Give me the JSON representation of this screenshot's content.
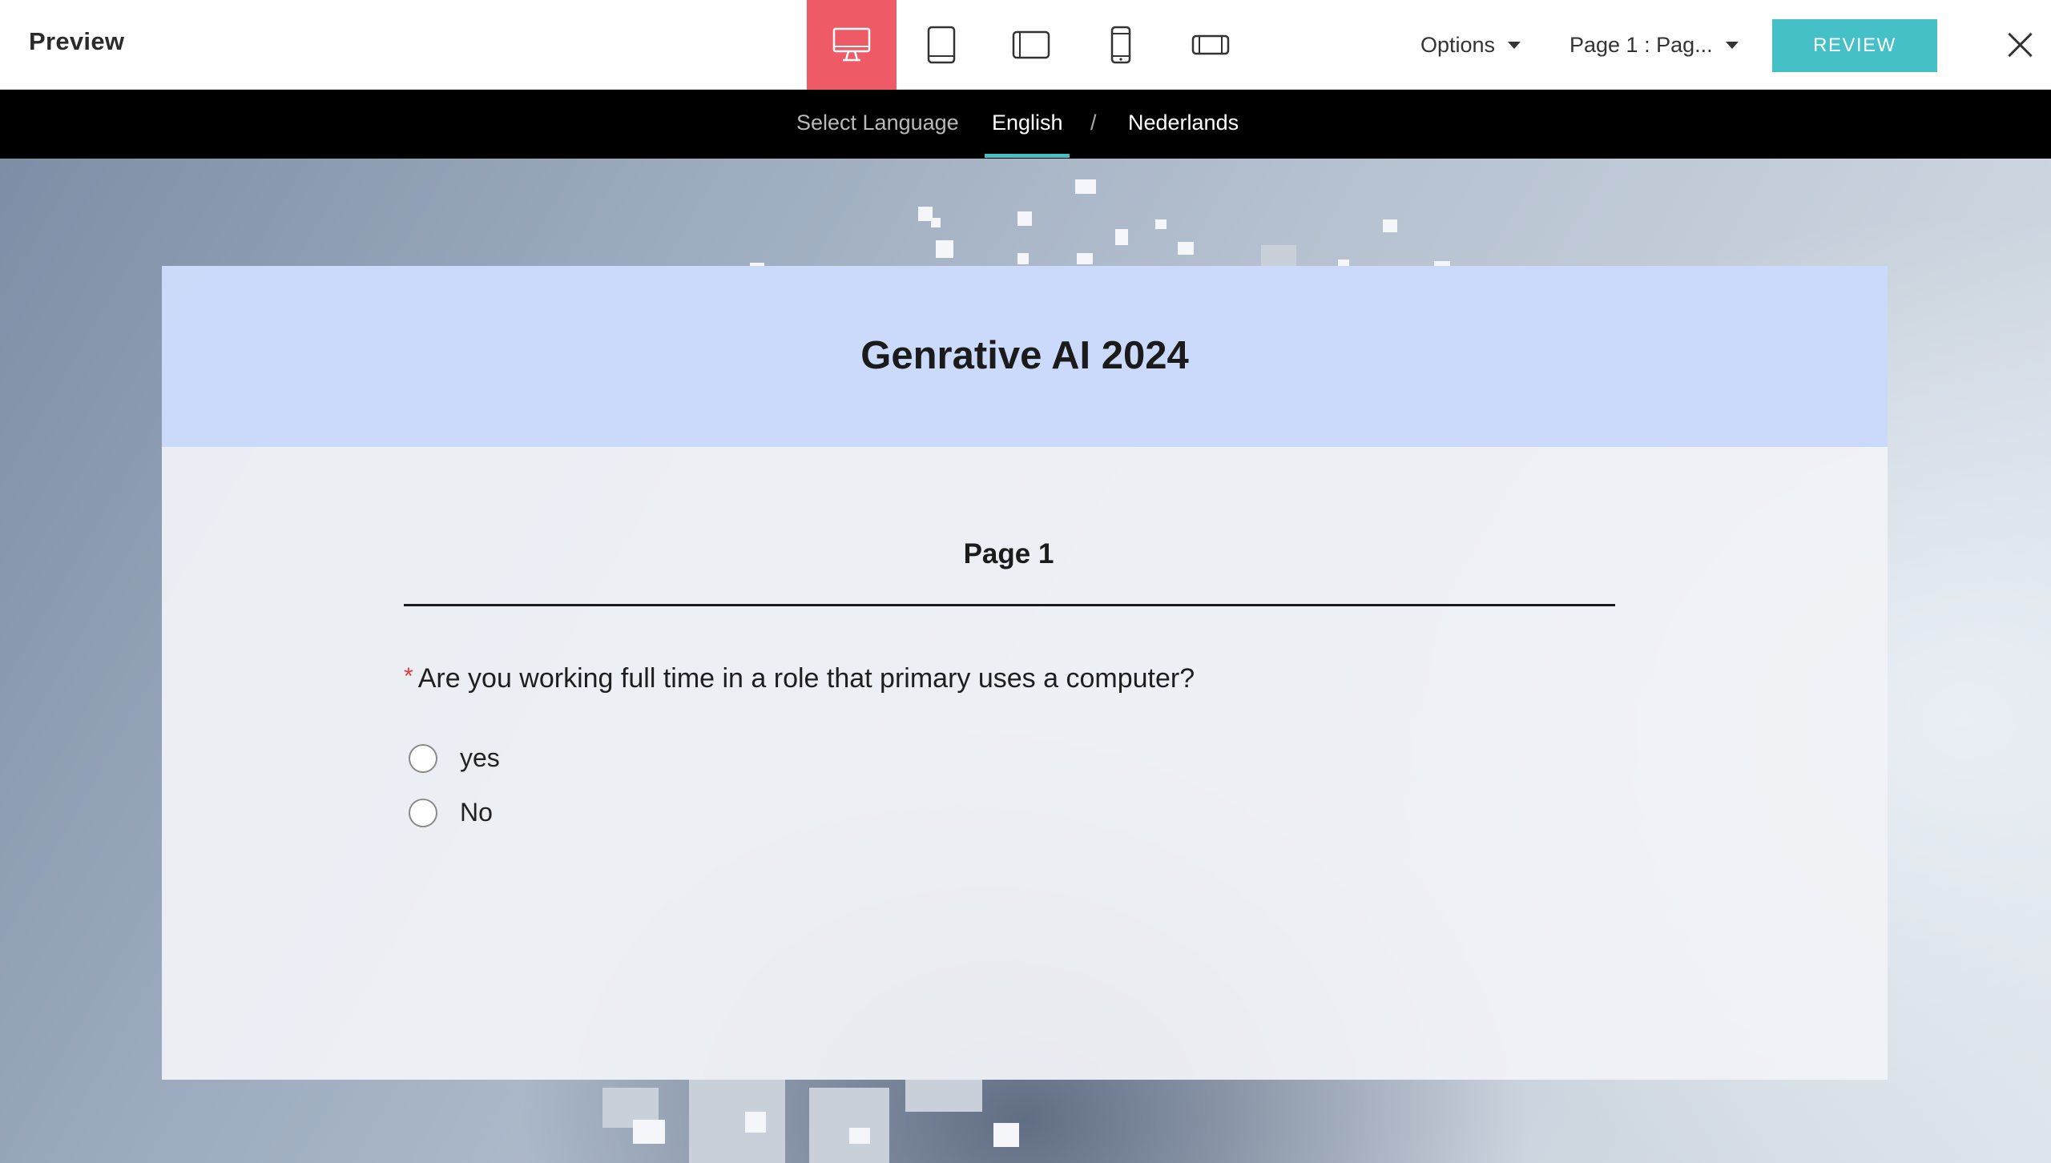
{
  "header": {
    "title": "Preview",
    "devices": [
      {
        "name": "desktop",
        "active": true
      },
      {
        "name": "tablet-portrait",
        "active": false
      },
      {
        "name": "tablet-landscape",
        "active": false
      },
      {
        "name": "mobile-portrait",
        "active": false
      },
      {
        "name": "mobile-landscape",
        "active": false
      }
    ],
    "options_label": "Options",
    "page_select_label": "Page 1 : Pag...",
    "review_label": "REVIEW"
  },
  "language_bar": {
    "label": "Select Language",
    "languages": [
      "English",
      "Nederlands"
    ],
    "separator": "/",
    "selected": "English"
  },
  "form": {
    "title": "Genrative AI 2024",
    "page_title": "Page 1",
    "question": {
      "required_marker": "*",
      "text": "Are you working full time in a role that primary  uses a computer?",
      "options": [
        "yes",
        "No"
      ]
    }
  },
  "colors": {
    "active_device": "#ee5b66",
    "review_button": "#45c0c6",
    "language_bar": "#000000",
    "form_header": "#c8d8fa",
    "required": "#e23c3c"
  }
}
